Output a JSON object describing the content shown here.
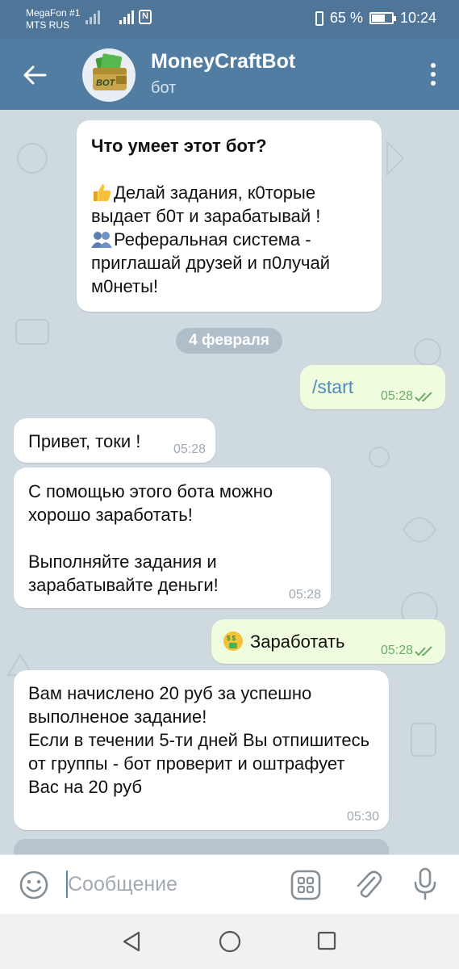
{
  "status_bar": {
    "carrier_line1": "MegaFon #1",
    "carrier_line2": "MTS RUS",
    "battery": "65 %",
    "battery_level": 0.65,
    "time": "10:24"
  },
  "header": {
    "title": "MoneyCraftBot",
    "subtitle": "бот",
    "avatar_text": "BOT"
  },
  "chat": {
    "about": {
      "title": "Что умеет этот бот?",
      "line1": "Делай задания, к0торые выдает б0т и зарабатывай !",
      "line2": "Реферальная система - приглашай друзей и п0лучай м0неты!"
    },
    "date_separator": "4 февраля",
    "messages": [
      {
        "text": "/start",
        "time": "05:28",
        "direction": "outgoing"
      },
      {
        "text": "Привет, токи !",
        "time": "05:28",
        "direction": "incoming"
      },
      {
        "text": "С помощью этого бота можно хорошо заработать!\n\nВыполняйте задания и зарабатывайте деньги!",
        "time": "05:28",
        "direction": "incoming"
      },
      {
        "text": "Заработать",
        "time": "05:28",
        "direction": "outgoing"
      },
      {
        "text": "Вам начислено 20 руб за успешно выполненое задание!\nЕсли в течении 5-ти дней Вы отпишитесь от группы - бот проверит и оштрафует Вас на 20 руб",
        "time": "05:30",
        "direction": "incoming"
      }
    ]
  },
  "input": {
    "placeholder": "Сообщение",
    "value": ""
  },
  "icons": {
    "back": "arrow-left-icon",
    "menu": "more-vertical-icon",
    "emoji": "smile-icon",
    "bot_keyboard": "grid-icon",
    "attach": "paperclip-icon",
    "mic": "microphone-icon"
  },
  "colors": {
    "header": "#527da3",
    "status_bar": "#4f7599",
    "outgoing_bubble": "#effdde",
    "incoming_bubble": "#ffffff",
    "chat_background": "#cfd9e0",
    "accent": "#4f8bbd"
  }
}
